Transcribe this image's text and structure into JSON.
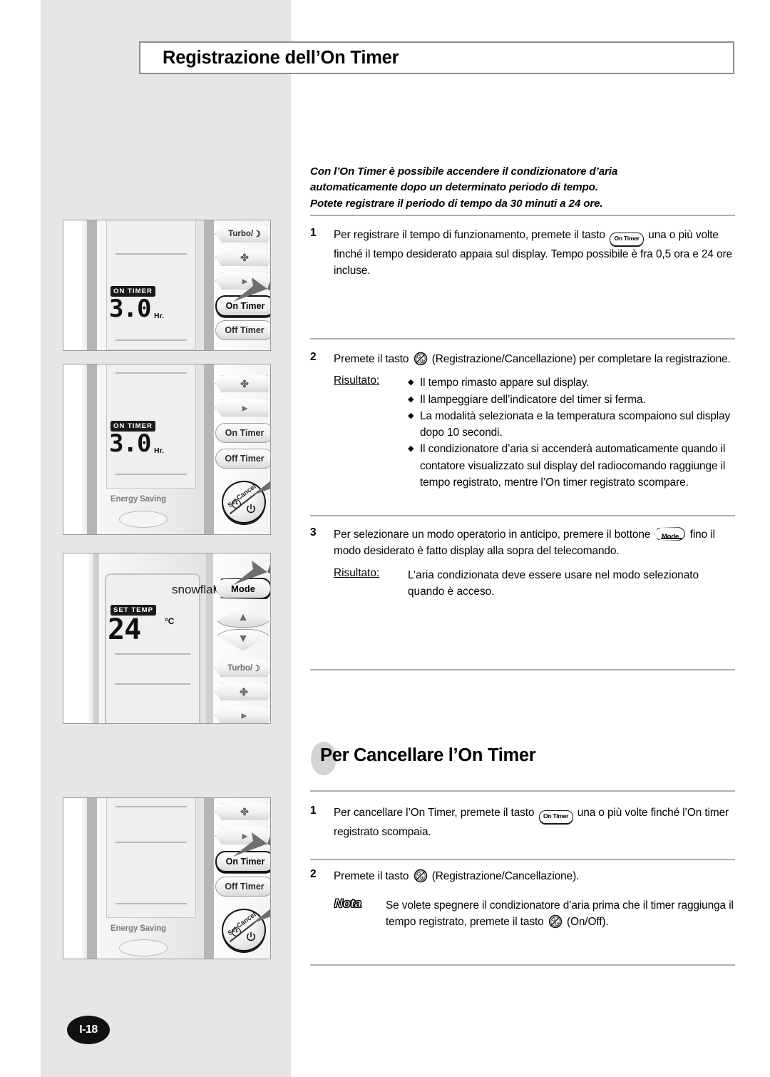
{
  "page": {
    "number": "I-18",
    "title": "Registrazione dell’On Timer",
    "heading2": "Per Cancellare l’On Timer"
  },
  "intro": {
    "line1": "Con l’On Timer è possibile accendere il condizionatore d’aria",
    "line2": "automaticamente dopo un determinato periodo di tempo.",
    "line3": "Potete registrare il periodo di tempo da 30 minuti a 24 ore."
  },
  "section1": {
    "steps": [
      {
        "num": "1",
        "text_a": "Per registrare il tempo di funzionamento, premete il tasto",
        "button": "On Timer",
        "text_b": "una o più volte finché il tempo desiderato appaia sul display. Tempo possibile è fra 0,5 ora e 24 ore incluse."
      },
      {
        "num": "2",
        "text_a": "Premete il tasto",
        "button": "set-cancel-icon",
        "text_b": "(Registrazione/Cancellazione) per completare la registrazione.",
        "result_label": "Risultato",
        "result_colon": ":",
        "bullets": [
          "Il tempo rimasto appare sul display.",
          "Il lampeggiare dell’indicatore del timer si ferma.",
          "La modalità selezionata e la temperatura scompaiono sul display dopo 10 secondi.",
          "Il condizionatore d’aria si accenderà automaticamente quando il contatore visualizzato sul display del radiocomando raggiunge il tempo registrato, mentre l’On timer registrato scompare."
        ]
      },
      {
        "num": "3",
        "text_a": "Per selezionare un modo operatorio in anticipo, premere il bottone",
        "button": "Mode",
        "text_b": "fino il modo desiderato è fatto display alla sopra del telecomando.",
        "result_label": "Risultato",
        "result_colon": ":",
        "result_text": "L’aria condizionata deve essere usare nel modo selezionato quando è acceso."
      }
    ]
  },
  "section2": {
    "steps": [
      {
        "num": "1",
        "text_a": "Per cancellare l’On Timer, premete il tasto",
        "button": "On Timer",
        "text_b": "una o più volte finché l’On timer registrato scompaia."
      },
      {
        "num": "2",
        "text_a": "Premete il tasto",
        "button": "set-cancel-icon",
        "text_b": "(Registrazione/Cancellazione)."
      }
    ],
    "note": {
      "label": "Nota",
      "text_a": "Se volete spegnere il condizionatore d’aria prima che il timer raggiunga il tempo registrato, premete il tasto",
      "button": "set-cancel-icon",
      "text_b": "(On/Off)."
    }
  },
  "illustrations": {
    "panel1": {
      "lcd_tag": "ON TIMER",
      "lcd_value": "3.0",
      "lcd_unit": "Hr.",
      "buttons": [
        "Turbo/",
        "fan-icon",
        "swing-icon",
        "On Timer",
        "Off Timer"
      ],
      "highlight": "On Timer"
    },
    "panel2": {
      "lcd_tag": "ON TIMER",
      "lcd_value": "3.0",
      "lcd_unit": "Hr.",
      "buttons": [
        "fan-icon",
        "swing-icon",
        "On Timer",
        "Off Timer"
      ],
      "set_button": {
        "set": "Set",
        "cancel": "Cancel"
      },
      "energy_saving": "Energy Saving",
      "highlight": "Set/Cancel"
    },
    "panel3": {
      "lcd_tag": "SET TEMP",
      "lcd_value": "24",
      "lcd_unit": "°C",
      "mode_icon": "snowflake-icon",
      "buttons": [
        "Mode",
        "up-icon",
        "down-icon",
        "Turbo/",
        "fan-icon",
        "swing-icon"
      ],
      "highlight": "Mode"
    },
    "panel4": {
      "buttons": [
        "fan-icon",
        "swing-icon",
        "On Timer",
        "Off Timer"
      ],
      "set_button": {
        "set": "Set",
        "cancel": "Cancel"
      },
      "energy_saving": "Energy Saving",
      "highlight": "On Timer + Set/Cancel"
    }
  }
}
